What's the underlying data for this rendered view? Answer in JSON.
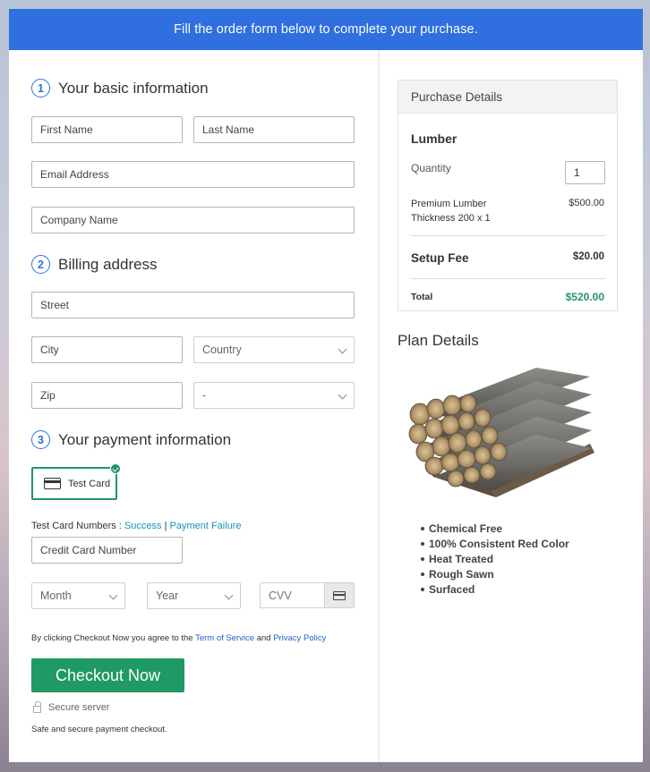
{
  "banner": {
    "text": "Fill the order form below to complete your purchase."
  },
  "form": {
    "sections": [
      {
        "number": "1",
        "title": "Your basic information"
      },
      {
        "number": "2",
        "title": "Billing address"
      },
      {
        "number": "3",
        "title": "Your payment information"
      }
    ],
    "basic": {
      "first_name_placeholder": "First Name",
      "last_name_placeholder": "Last Name",
      "email_placeholder": "Email Address",
      "company_placeholder": "Company Name"
    },
    "billing": {
      "street_placeholder": "Street",
      "city_placeholder": "City",
      "country_selected": "Country",
      "zip_placeholder": "Zip",
      "state_selected": "-"
    },
    "payment": {
      "option_label": "Test Card",
      "option_icon": "credit-card-icon",
      "test_numbers_label": "Test Card Numbers :",
      "success_link": "Success",
      "separator": "|",
      "failure_link": "Payment Failure",
      "card_number_placeholder": "Credit Card Number",
      "month_selected": "Month",
      "year_selected": "Year",
      "cvv_placeholder": "CVV"
    },
    "terms": {
      "prefix": "By clicking Checkout Now you agree to the",
      "terms_link": "Term of Service",
      "and": "and",
      "privacy_link": "Privacy Policy"
    },
    "checkout_button": "Checkout Now",
    "secure_label": "Secure server",
    "safe_text": "Safe and secure payment checkout."
  },
  "purchase": {
    "header": "Purchase Details",
    "product_name": "Lumber",
    "quantity_label": "Quantity",
    "quantity_value": "1",
    "item_line1": "Premium Lumber",
    "item_line2": "Thickness 200 x 1",
    "item_price": "$500.00",
    "setup_fee_label": "Setup Fee",
    "setup_fee_value": "$20.00",
    "total_label": "Total",
    "total_value": "$520.00",
    "total_color": "#22946a"
  },
  "plan": {
    "title": "Plan Details",
    "image_alt": "stacked lumber logs on pallet",
    "features": [
      "Chemical Free",
      "100% Consistent Red Color",
      "Heat Treated",
      "Rough Sawn",
      "Surfaced"
    ]
  },
  "colors": {
    "banner": "#2f6fe0",
    "accent_green": "#1f9a64",
    "link": "#1a8fb2"
  }
}
